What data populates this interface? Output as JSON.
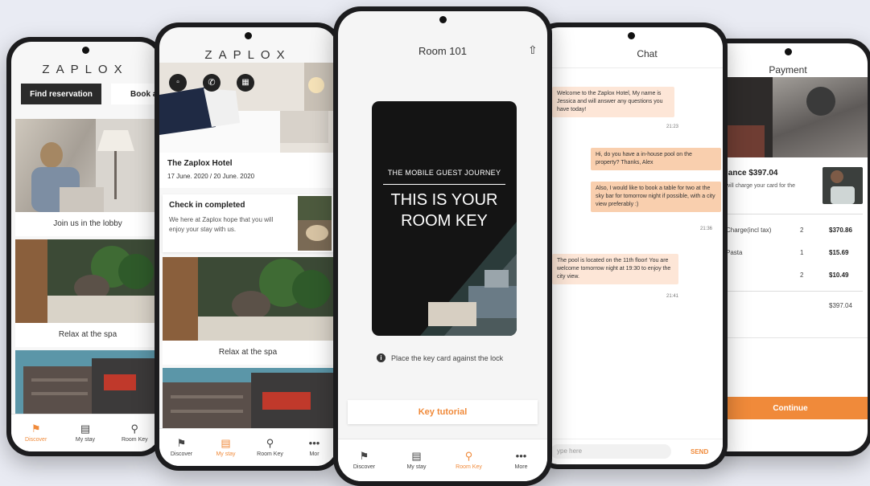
{
  "brand": "ZAPLOX",
  "colors": {
    "accent": "#f08a3a",
    "bubble_in": "#fde6d7",
    "bubble_out": "#f9cfae",
    "key_card": "#141414"
  },
  "phone1": {
    "find_button": "Find reservation",
    "book_button": "Book a",
    "cards": [
      "Join us in the lobby",
      "Relax at the spa"
    ],
    "nav": [
      {
        "label": "Discover",
        "icon": "tag-icon"
      },
      {
        "label": "My stay",
        "icon": "bed-icon"
      },
      {
        "label": "Room Key",
        "icon": "key-icon"
      }
    ]
  },
  "phone2": {
    "hotel_name": "The Zaplox Hotel",
    "dates": "17 June. 2020 / 20 June. 2020",
    "checkin_title": "Check in completed",
    "checkin_body": "We here at Zaplox hope that you will enjoy your stay with us.",
    "spa_label": "Relax at the spa",
    "nav": [
      {
        "label": "Discover",
        "icon": "tag-icon"
      },
      {
        "label": "My stay",
        "icon": "bed-icon"
      },
      {
        "label": "Room Key",
        "icon": "key-icon"
      },
      {
        "label": "Mor",
        "icon": "more-icon"
      }
    ]
  },
  "phone3": {
    "title": "Room 101",
    "card_small": "THE MOBILE GUEST JOURNEY",
    "card_big_1": "THIS IS YOUR",
    "card_big_2": "ROOM KEY",
    "hint": "Place the key card against the lock",
    "tutorial_button": "Key tutorial",
    "nav": [
      {
        "label": "Discover",
        "icon": "tag-icon"
      },
      {
        "label": "My stay",
        "icon": "bed-icon"
      },
      {
        "label": "Room Key",
        "icon": "key-icon"
      },
      {
        "label": "More",
        "icon": "more-icon"
      }
    ]
  },
  "phone4": {
    "title": "Chat",
    "messages": [
      {
        "text": "Welcome to the Zaplox Hotel, My name is Jessica and will answer any questions you have today!",
        "time": "21:23"
      },
      {
        "text": "Hi, do you have a in-house pool on the property? Thanks, Alex"
      },
      {
        "text": "Also, I would like to book a table for two at the sky bar for tomorrow night if possible, with a city view preferably :)",
        "time": "21:36"
      },
      {
        "text": "The pool is located on the 11th floor! You are welcome tomorrow night at 19:30 to enjoy the city view.",
        "time": "21:41"
      }
    ],
    "input_placeholder": "ype here",
    "send_label": "SEND"
  },
  "phone5": {
    "title": "Payment",
    "balance": "lance $397.04",
    "charge_note": "will charge your card for the",
    "rows": [
      {
        "name": "Charge(incl tax)",
        "qty": "2",
        "price": "$370.86"
      },
      {
        "name": "Pasta",
        "qty": "1",
        "price": "$15.69"
      },
      {
        "name": "",
        "qty": "2",
        "price": "$10.49"
      }
    ],
    "total": "$397.04",
    "continue_button": "Continue"
  }
}
